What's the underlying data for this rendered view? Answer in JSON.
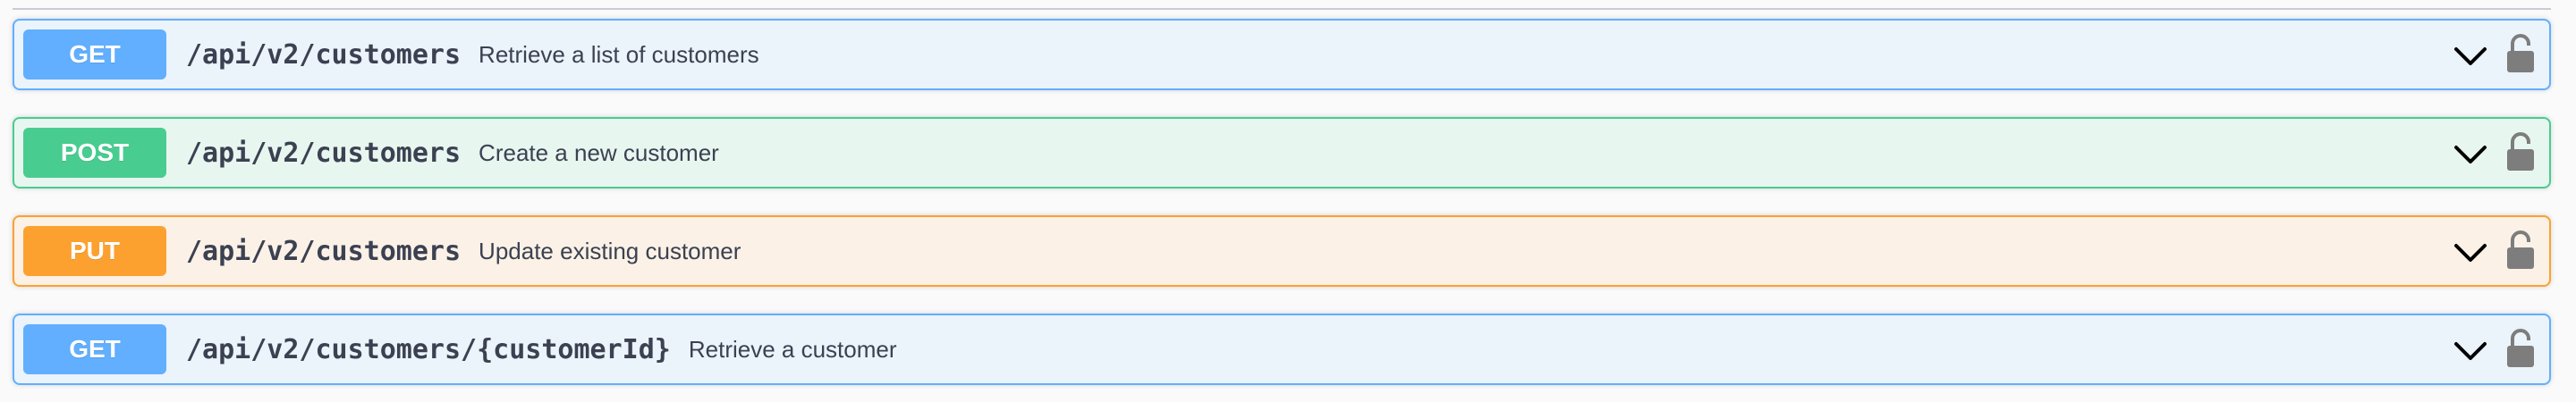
{
  "operations": [
    {
      "method": "GET",
      "path": "/api/v2/customers",
      "summary": "Retrieve a list of customers",
      "chevron_icon": "chevron-down-icon",
      "lock_icon": "lock-icon"
    },
    {
      "method": "POST",
      "path": "/api/v2/customers",
      "summary": "Create a new customer",
      "chevron_icon": "chevron-down-icon",
      "lock_icon": "lock-icon"
    },
    {
      "method": "PUT",
      "path": "/api/v2/customers",
      "summary": "Update existing customer",
      "chevron_icon": "chevron-down-icon",
      "lock_icon": "lock-icon"
    },
    {
      "method": "GET",
      "path": "/api/v2/customers/{customerId}",
      "summary": "Retrieve a customer",
      "chevron_icon": "chevron-down-icon",
      "lock_icon": "lock-icon"
    }
  ],
  "colors": {
    "get": "#61affe",
    "post": "#49cc90",
    "put": "#fca130",
    "text": "#3b4151",
    "icon": "#7d7d7d"
  }
}
